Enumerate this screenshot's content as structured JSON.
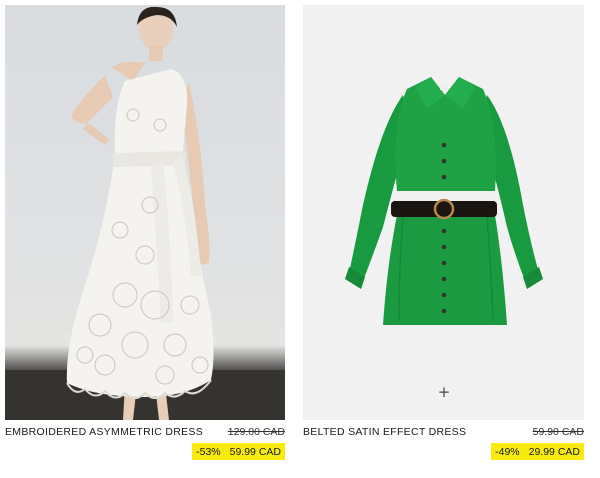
{
  "products": [
    {
      "name": "EMBROIDERED ASYMMETRIC DRESS",
      "original_price": "129.00 CAD",
      "discount": "-53%",
      "sale_price": "59.99 CAD",
      "image_icon": "white-embroidered-dress-photo"
    },
    {
      "name": "BELTED SATIN EFFECT DRESS",
      "original_price": "59.90 CAD",
      "discount": "-49%",
      "sale_price": "29.99 CAD",
      "image_icon": "green-satin-dress-photo",
      "add_button_label": "+"
    }
  ],
  "colors": {
    "sale_highlight": "#f6ea0f",
    "dress_green": "#1fa145",
    "dress_white": "#f4f3ef"
  }
}
